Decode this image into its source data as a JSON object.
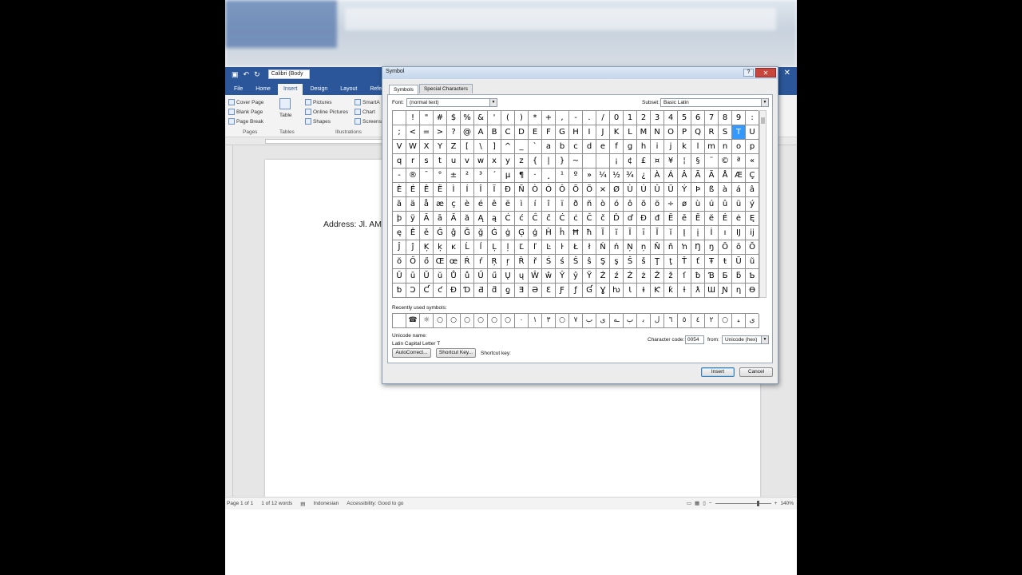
{
  "word": {
    "font_box": "Calibri (Body",
    "tabs": [
      "File",
      "Home",
      "Insert",
      "Design",
      "Layout",
      "Refere"
    ],
    "active_tab": "Insert",
    "ribbon": {
      "pages_group": [
        "Cover Page",
        "Blank Page",
        "Page Break"
      ],
      "pages_label": "Pages",
      "table_label": "Table",
      "tables_label": "Tables",
      "illustrations_items": [
        "Pictures",
        "Online Pictures",
        "Shapes"
      ],
      "illustrations_extra": [
        "SmartA",
        "Chart",
        "Screens"
      ],
      "illustrations_label": "Illustrations"
    },
    "document_text": "Address: Jl. AM",
    "status": {
      "page": "Page 1 of 1",
      "words": "1 of 12 words",
      "language": "Indonesian",
      "accessibility": "Accessibility: Good to go",
      "zoom": "140%"
    }
  },
  "dialog": {
    "title": "Symbol",
    "tabs": [
      "Symbols",
      "Special Characters"
    ],
    "font_label": "Font:",
    "font_value": "(normal text)",
    "subset_label": "Subset:",
    "subset_value": "Basic Latin",
    "selected_symbol": "T",
    "recent_label": "Recently used symbols:",
    "unicode_name_label": "Unicode name:",
    "unicode_name": "Latin Capital Letter T",
    "char_code_label": "Character code:",
    "char_code": "0054",
    "from_label": "from:",
    "from_value": "Unicode (hex)",
    "autocorrect_btn": "AutoCorrect...",
    "shortcut_btn": "Shortcut Key...",
    "shortcut_key_label": "Shortcut key:",
    "insert_btn": "Insert",
    "cancel_btn": "Cancel",
    "grid_rows": [
      [
        " ",
        "!",
        "\"",
        "#",
        "$",
        "%",
        "&",
        "'",
        "(",
        ")",
        "*",
        "+",
        ",",
        "-",
        ".",
        "/",
        "0",
        "1",
        "2",
        "3",
        "4",
        "5",
        "6",
        "7",
        "8",
        "9",
        ":"
      ],
      [
        ";",
        "<",
        "=",
        ">",
        "?",
        "@",
        "A",
        "B",
        "C",
        "D",
        "E",
        "F",
        "G",
        "H",
        "I",
        "J",
        "K",
        "L",
        "M",
        "N",
        "O",
        "P",
        "Q",
        "R",
        "S",
        "T",
        "U"
      ],
      [
        "V",
        "W",
        "X",
        "Y",
        "Z",
        "[",
        "\\",
        "]",
        "^",
        "_",
        "`",
        "a",
        "b",
        "c",
        "d",
        "e",
        "f",
        "g",
        "h",
        "i",
        "j",
        "k",
        "l",
        "m",
        "n",
        "o",
        "p"
      ],
      [
        "q",
        "r",
        "s",
        "t",
        "u",
        "v",
        "w",
        "x",
        "y",
        "z",
        "{",
        "|",
        "}",
        "~",
        " ",
        " ",
        "¡",
        "¢",
        "£",
        "¤",
        "¥",
        "¦",
        "§",
        "¨",
        "©",
        "ª",
        "«"
      ],
      [
        "-",
        "®",
        "¯",
        "°",
        "±",
        "²",
        "³",
        "´",
        "µ",
        "¶",
        "·",
        "¸",
        "¹",
        "º",
        "»",
        "¼",
        "½",
        "¾",
        "¿",
        "À",
        "Á",
        "Â",
        "Ã",
        "Ä",
        "Å",
        "Æ",
        "Ç"
      ],
      [
        "È",
        "É",
        "Ê",
        "Ë",
        "Ì",
        "Í",
        "Î",
        "Ï",
        "Ð",
        "Ñ",
        "Ò",
        "Ó",
        "Ô",
        "Õ",
        "Ö",
        "×",
        "Ø",
        "Ù",
        "Ú",
        "Û",
        "Ü",
        "Ý",
        "Þ",
        "ß",
        "à",
        "á",
        "â"
      ],
      [
        "ã",
        "ä",
        "å",
        "æ",
        "ç",
        "è",
        "é",
        "ê",
        "ë",
        "ì",
        "í",
        "î",
        "ï",
        "ð",
        "ñ",
        "ò",
        "ó",
        "ô",
        "õ",
        "ö",
        "÷",
        "ø",
        "ù",
        "ú",
        "û",
        "ü",
        "ý"
      ],
      [
        "þ",
        "ÿ",
        "Ā",
        "ā",
        "Ă",
        "ă",
        "Ą",
        "ą",
        "Ć",
        "ć",
        "Ĉ",
        "ĉ",
        "Ċ",
        "ċ",
        "Č",
        "č",
        "Ď",
        "ď",
        "Đ",
        "đ",
        "Ē",
        "ē",
        "Ĕ",
        "ĕ",
        "Ė",
        "ė",
        "Ę"
      ],
      [
        "ę",
        "Ě",
        "ě",
        "Ĝ",
        "ĝ",
        "Ğ",
        "ğ",
        "Ġ",
        "ġ",
        "Ģ",
        "ģ",
        "Ĥ",
        "ĥ",
        "Ħ",
        "ħ",
        "Ĩ",
        "ĩ",
        "Ī",
        "ī",
        "Ĭ",
        "ĭ",
        "Į",
        "į",
        "İ",
        "ı",
        "Ĳ",
        "ĳ"
      ],
      [
        "Ĵ",
        "ĵ",
        "Ķ",
        "ķ",
        "ĸ",
        "Ĺ",
        "ĺ",
        "Ļ",
        "ļ",
        "Ľ",
        "ľ",
        "Ŀ",
        "ŀ",
        "Ł",
        "ł",
        "Ń",
        "ń",
        "Ņ",
        "ņ",
        "Ň",
        "ň",
        "ŉ",
        "Ŋ",
        "ŋ",
        "Ō",
        "ō",
        "Ŏ"
      ],
      [
        "ŏ",
        "Ő",
        "ő",
        "Œ",
        "œ",
        "Ŕ",
        "ŕ",
        "Ŗ",
        "ŗ",
        "Ř",
        "ř",
        "Ś",
        "ś",
        "Ŝ",
        "ŝ",
        "Ş",
        "ş",
        "Š",
        "š",
        "Ţ",
        "ţ",
        "Ť",
        "ť",
        "Ŧ",
        "ŧ",
        "Ũ",
        "ũ"
      ],
      [
        "Ū",
        "ū",
        "Ŭ",
        "ŭ",
        "Ů",
        "ů",
        "Ű",
        "ű",
        "Ų",
        "ų",
        "Ŵ",
        "ŵ",
        "Ŷ",
        "ŷ",
        "Ÿ",
        "Ź",
        "ź",
        "Ż",
        "ż",
        "Ž",
        "ž",
        "ſ",
        "ƀ",
        "Ɓ",
        "Ƃ",
        "ƃ",
        "Ƅ"
      ],
      [
        "ƅ",
        "Ɔ",
        "Ƈ",
        "ƈ",
        "Ɖ",
        "Ɗ",
        "Ƌ",
        "ƌ",
        "ƍ",
        "Ǝ",
        "Ə",
        "Ɛ",
        "Ƒ",
        "ƒ",
        "Ɠ",
        "Ɣ",
        "ƕ",
        "Ɩ",
        "Ɨ",
        "Ƙ",
        "ƙ",
        "ƚ",
        "ƛ",
        "Ɯ",
        "Ɲ",
        "ƞ",
        "Ɵ"
      ]
    ],
    "recent_symbols": [
      " ",
      "☎",
      "☼",
      "○",
      "○",
      "○",
      "○",
      "○",
      "○",
      "٠",
      "١",
      "٣",
      "○",
      "٧",
      "ب",
      "ى",
      "ـه",
      "ب",
      "ﺑ",
      "ﻝ",
      "٦",
      "٥",
      "٤",
      "٢",
      "○",
      "ﺒ",
      "ى"
    ]
  }
}
